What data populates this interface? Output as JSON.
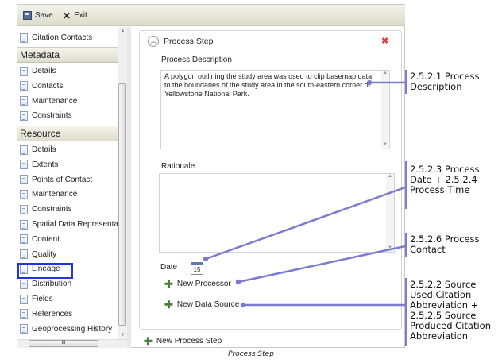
{
  "toolbar": {
    "save": "Save",
    "exit": "Exit"
  },
  "sidebar": {
    "top_item": "Citation Contacts",
    "metadata_header": "Metadata",
    "metadata_items": [
      "Details",
      "Contacts",
      "Maintenance",
      "Constraints"
    ],
    "resource_header": "Resource",
    "resource_items": [
      "Details",
      "Extents",
      "Points of Contact",
      "Maintenance",
      "Constraints",
      "Spatial Data Representat",
      "Content",
      "Quality",
      "Lineage",
      "Distribution",
      "Fields",
      "References",
      "Geoprocessing History"
    ],
    "selected": "Lineage"
  },
  "panel": {
    "title": "Process Step",
    "description_label": "Process Description",
    "description_value": "A polygon outlining the study area was used to clip basemap data to the boundaries of the study area in the south-eastern corner of Yellowstone National Park.",
    "rationale_label": "Rationale",
    "rationale_value": "",
    "date_label": "Date",
    "calendar_day": "15",
    "new_processor": "New Processor",
    "new_data_source": "New Data Source"
  },
  "new_process_step": "New Process Step",
  "callouts": [
    "2.5.2.1 Process Description",
    "2.5.2.3 Process Date + 2.5.2.4 Process Time",
    "2.5.2.6 Process Contact",
    "2.5.2.2 Source Used Citation Abbreviation + 2.5.2.5 Source Produced Citation Abbreviation"
  ],
  "caption": "Process Step",
  "colors": {
    "callout_line": "#7b7bd0",
    "selection": "#1f35e0"
  }
}
